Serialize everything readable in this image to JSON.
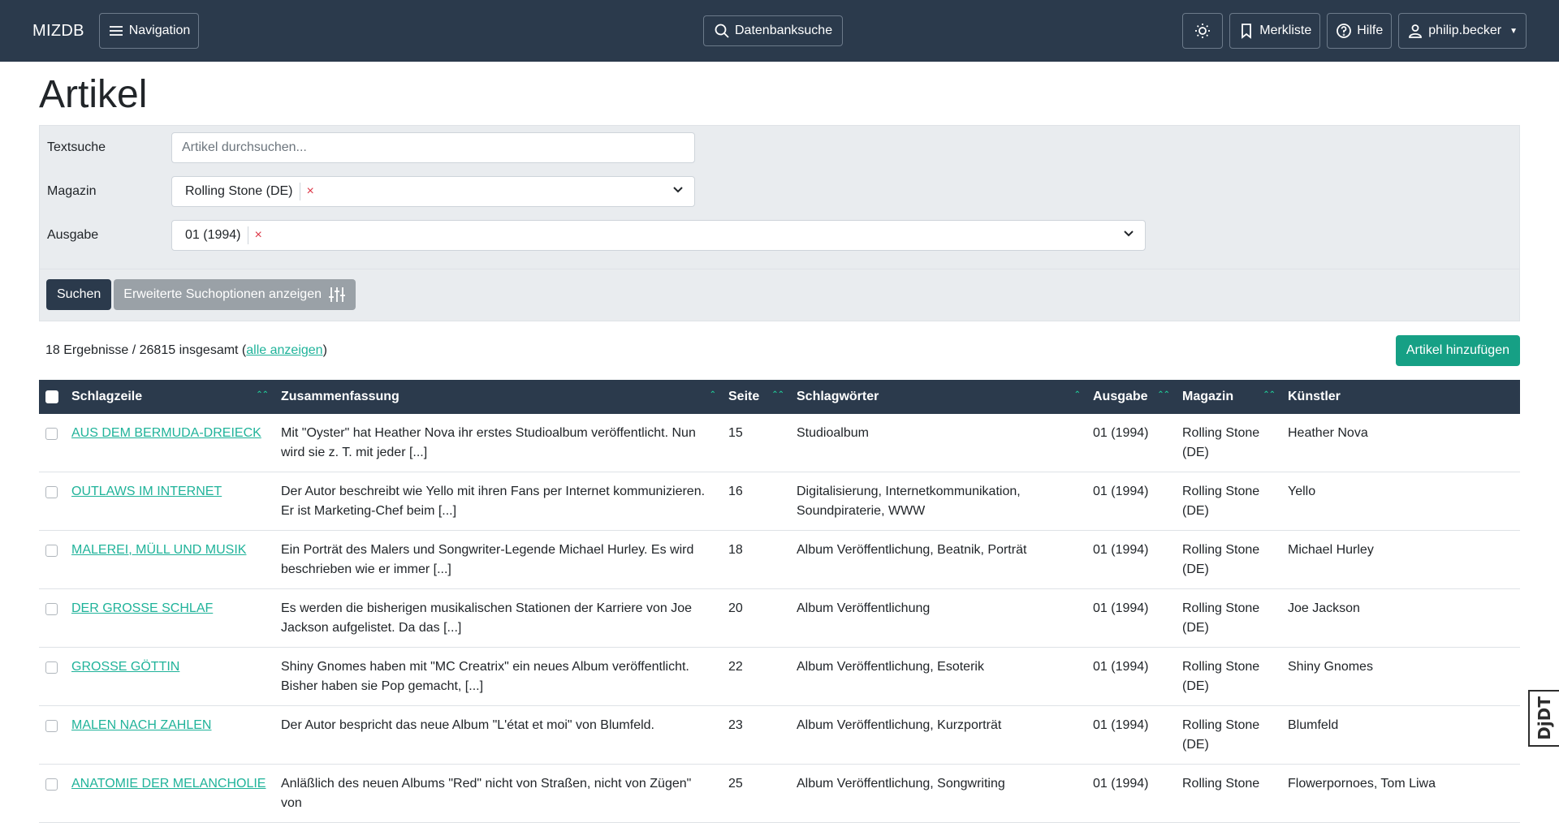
{
  "navbar": {
    "brand": "MIZDB",
    "navigation_label": "Navigation",
    "search_label": "Datenbanksuche",
    "watchlist_label": "Merkliste",
    "help_label": "Hilfe",
    "user_label": "philip.becker"
  },
  "page": {
    "title": "Artikel"
  },
  "search": {
    "textsuche_label": "Textsuche",
    "textsuche_placeholder": "Artikel durchsuchen...",
    "magazin_label": "Magazin",
    "magazin_value": "Rolling Stone (DE)",
    "ausgabe_label": "Ausgabe",
    "ausgabe_value": "01 (1994)",
    "remove_symbol": "×",
    "submit_label": "Suchen",
    "advanced_label": "Erweiterte Suchoptionen anzeigen"
  },
  "results": {
    "prefix": "18 Ergebnisse / 26815 insgesamt (",
    "show_all_label": "alle anzeigen",
    "suffix": ")",
    "add_label": "Artikel hinzufügen"
  },
  "table": {
    "columns": [
      "Schlagzeile",
      "Zusammenfassung",
      "Seite",
      "Schlagwörter",
      "Ausgabe",
      "Magazin",
      "Künstler"
    ],
    "rows": [
      {
        "schlagzeile": "AUS DEM BERMUDA-DREIECK",
        "zusammenfassung": "Mit \"Oyster\" hat Heather Nova ihr erstes Studioalbum veröffentlicht. Nun wird sie z. T. mit jeder [...]",
        "seite": "15",
        "schlagwoerter": "Studioalbum",
        "ausgabe": "01 (1994)",
        "magazin": "Rolling Stone (DE)",
        "kuenstler": "Heather Nova"
      },
      {
        "schlagzeile": "OUTLAWS IM INTERNET",
        "zusammenfassung": "Der Autor beschreibt wie Yello mit ihren Fans per Internet kommunizieren. Er ist Marketing-Chef beim [...]",
        "seite": "16",
        "schlagwoerter": "Digitalisierung, Internetkommunikation, Soundpiraterie, WWW",
        "ausgabe": "01 (1994)",
        "magazin": "Rolling Stone (DE)",
        "kuenstler": "Yello"
      },
      {
        "schlagzeile": "MALEREI, MÜLL UND MUSIK",
        "zusammenfassung": "Ein Porträt des Malers und Songwriter-Legende Michael Hurley. Es wird beschrieben wie er immer [...]",
        "seite": "18",
        "schlagwoerter": "Album Veröffentlichung, Beatnik, Porträt",
        "ausgabe": "01 (1994)",
        "magazin": "Rolling Stone (DE)",
        "kuenstler": "Michael Hurley"
      },
      {
        "schlagzeile": "DER GROSSE SCHLAF",
        "zusammenfassung": "Es werden die bisherigen musikalischen Stationen der Karriere von Joe Jackson aufgelistet. Da das [...]",
        "seite": "20",
        "schlagwoerter": "Album Veröffentlichung",
        "ausgabe": "01 (1994)",
        "magazin": "Rolling Stone (DE)",
        "kuenstler": "Joe Jackson"
      },
      {
        "schlagzeile": "GROSSE GÖTTIN",
        "zusammenfassung": "Shiny Gnomes haben mit \"MC Creatrix\" ein neues Album veröffentlicht. Bisher haben sie Pop gemacht, [...]",
        "seite": "22",
        "schlagwoerter": "Album Veröffentlichung, Esoterik",
        "ausgabe": "01 (1994)",
        "magazin": "Rolling Stone (DE)",
        "kuenstler": "Shiny Gnomes"
      },
      {
        "schlagzeile": "MALEN NACH ZAHLEN",
        "zusammenfassung": "Der Autor bespricht das neue Album \"L'état et moi\" von Blumfeld.",
        "seite": "23",
        "schlagwoerter": "Album Veröffentlichung, Kurzporträt",
        "ausgabe": "01 (1994)",
        "magazin": "Rolling Stone (DE)",
        "kuenstler": "Blumfeld"
      },
      {
        "schlagzeile": "ANATOMIE DER MELANCHOLIE",
        "zusammenfassung": "Anläßlich des neuen Albums \"Red\" nicht von Straßen, nicht von Zügen\" von",
        "seite": "25",
        "schlagwoerter": "Album Veröffentlichung, Songwriting",
        "ausgabe": "01 (1994)",
        "magazin": "Rolling Stone",
        "kuenstler": "Flowerpornoes, Tom Liwa"
      }
    ]
  },
  "debug_toolbar": {
    "label": "DjDT"
  }
}
